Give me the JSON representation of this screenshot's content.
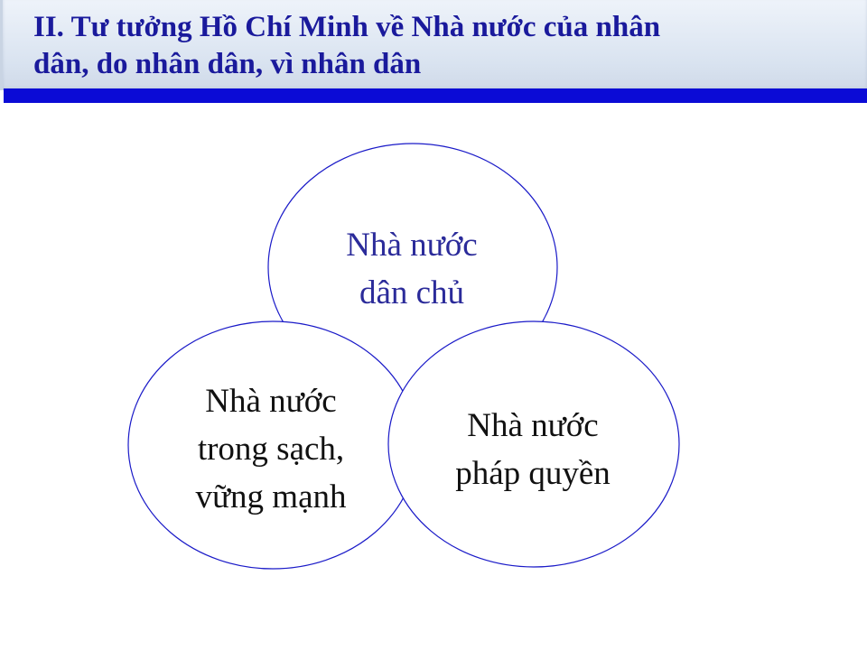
{
  "title": {
    "line1": "II. Tư tưởng Hồ Chí Minh về Nhà nước của nhân",
    "line2": "dân, do nhân dân, vì nhân dân"
  },
  "diagram": {
    "top_circle": {
      "line1": "Nhà nước",
      "line2": "dân chủ"
    },
    "left_circle": {
      "line1": "Nhà nước",
      "line2": "trong sạch,",
      "line3": "vững mạnh"
    },
    "right_circle": {
      "line1": "Nhà nước",
      "line2": "pháp quyền"
    }
  },
  "colors": {
    "title_text": "#1a1a9c",
    "title_bar": "#0b0bd6",
    "circle_stroke": "#1a1ac8",
    "top_label": "#2b2b9a",
    "body_label": "#111111"
  }
}
